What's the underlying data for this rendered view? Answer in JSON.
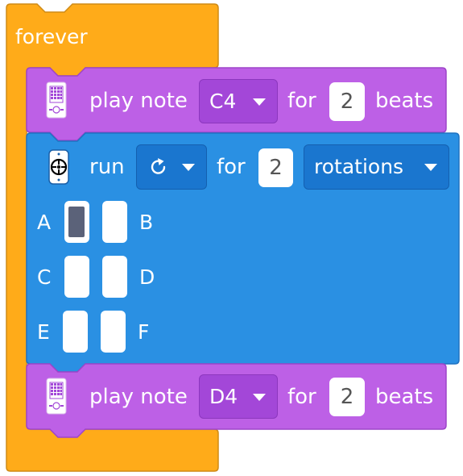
{
  "colors": {
    "forever": "#ffab19",
    "sound": "#bd60e6",
    "motor": "#2a90e3",
    "port_active": "#5b6279"
  },
  "forever_block": {
    "label": "forever"
  },
  "note_block_1": {
    "label": "play note",
    "note": "C4",
    "for_label": "for",
    "beats": "2",
    "beats_label": "beats",
    "icon": "sound-hub-icon"
  },
  "motor_block": {
    "label": "run",
    "direction_icon": "rotate-clockwise-icon",
    "for_label": "for",
    "amount": "2",
    "unit": "rotations",
    "icon": "motor-icon",
    "ports": [
      {
        "name": "A",
        "selected": true
      },
      {
        "name": "B",
        "selected": false
      },
      {
        "name": "C",
        "selected": false
      },
      {
        "name": "D",
        "selected": false
      },
      {
        "name": "E",
        "selected": false
      },
      {
        "name": "F",
        "selected": false
      }
    ]
  },
  "note_block_2": {
    "label": "play note",
    "note": "D4",
    "for_label": "for",
    "beats": "2",
    "beats_label": "beats",
    "icon": "sound-hub-icon"
  }
}
